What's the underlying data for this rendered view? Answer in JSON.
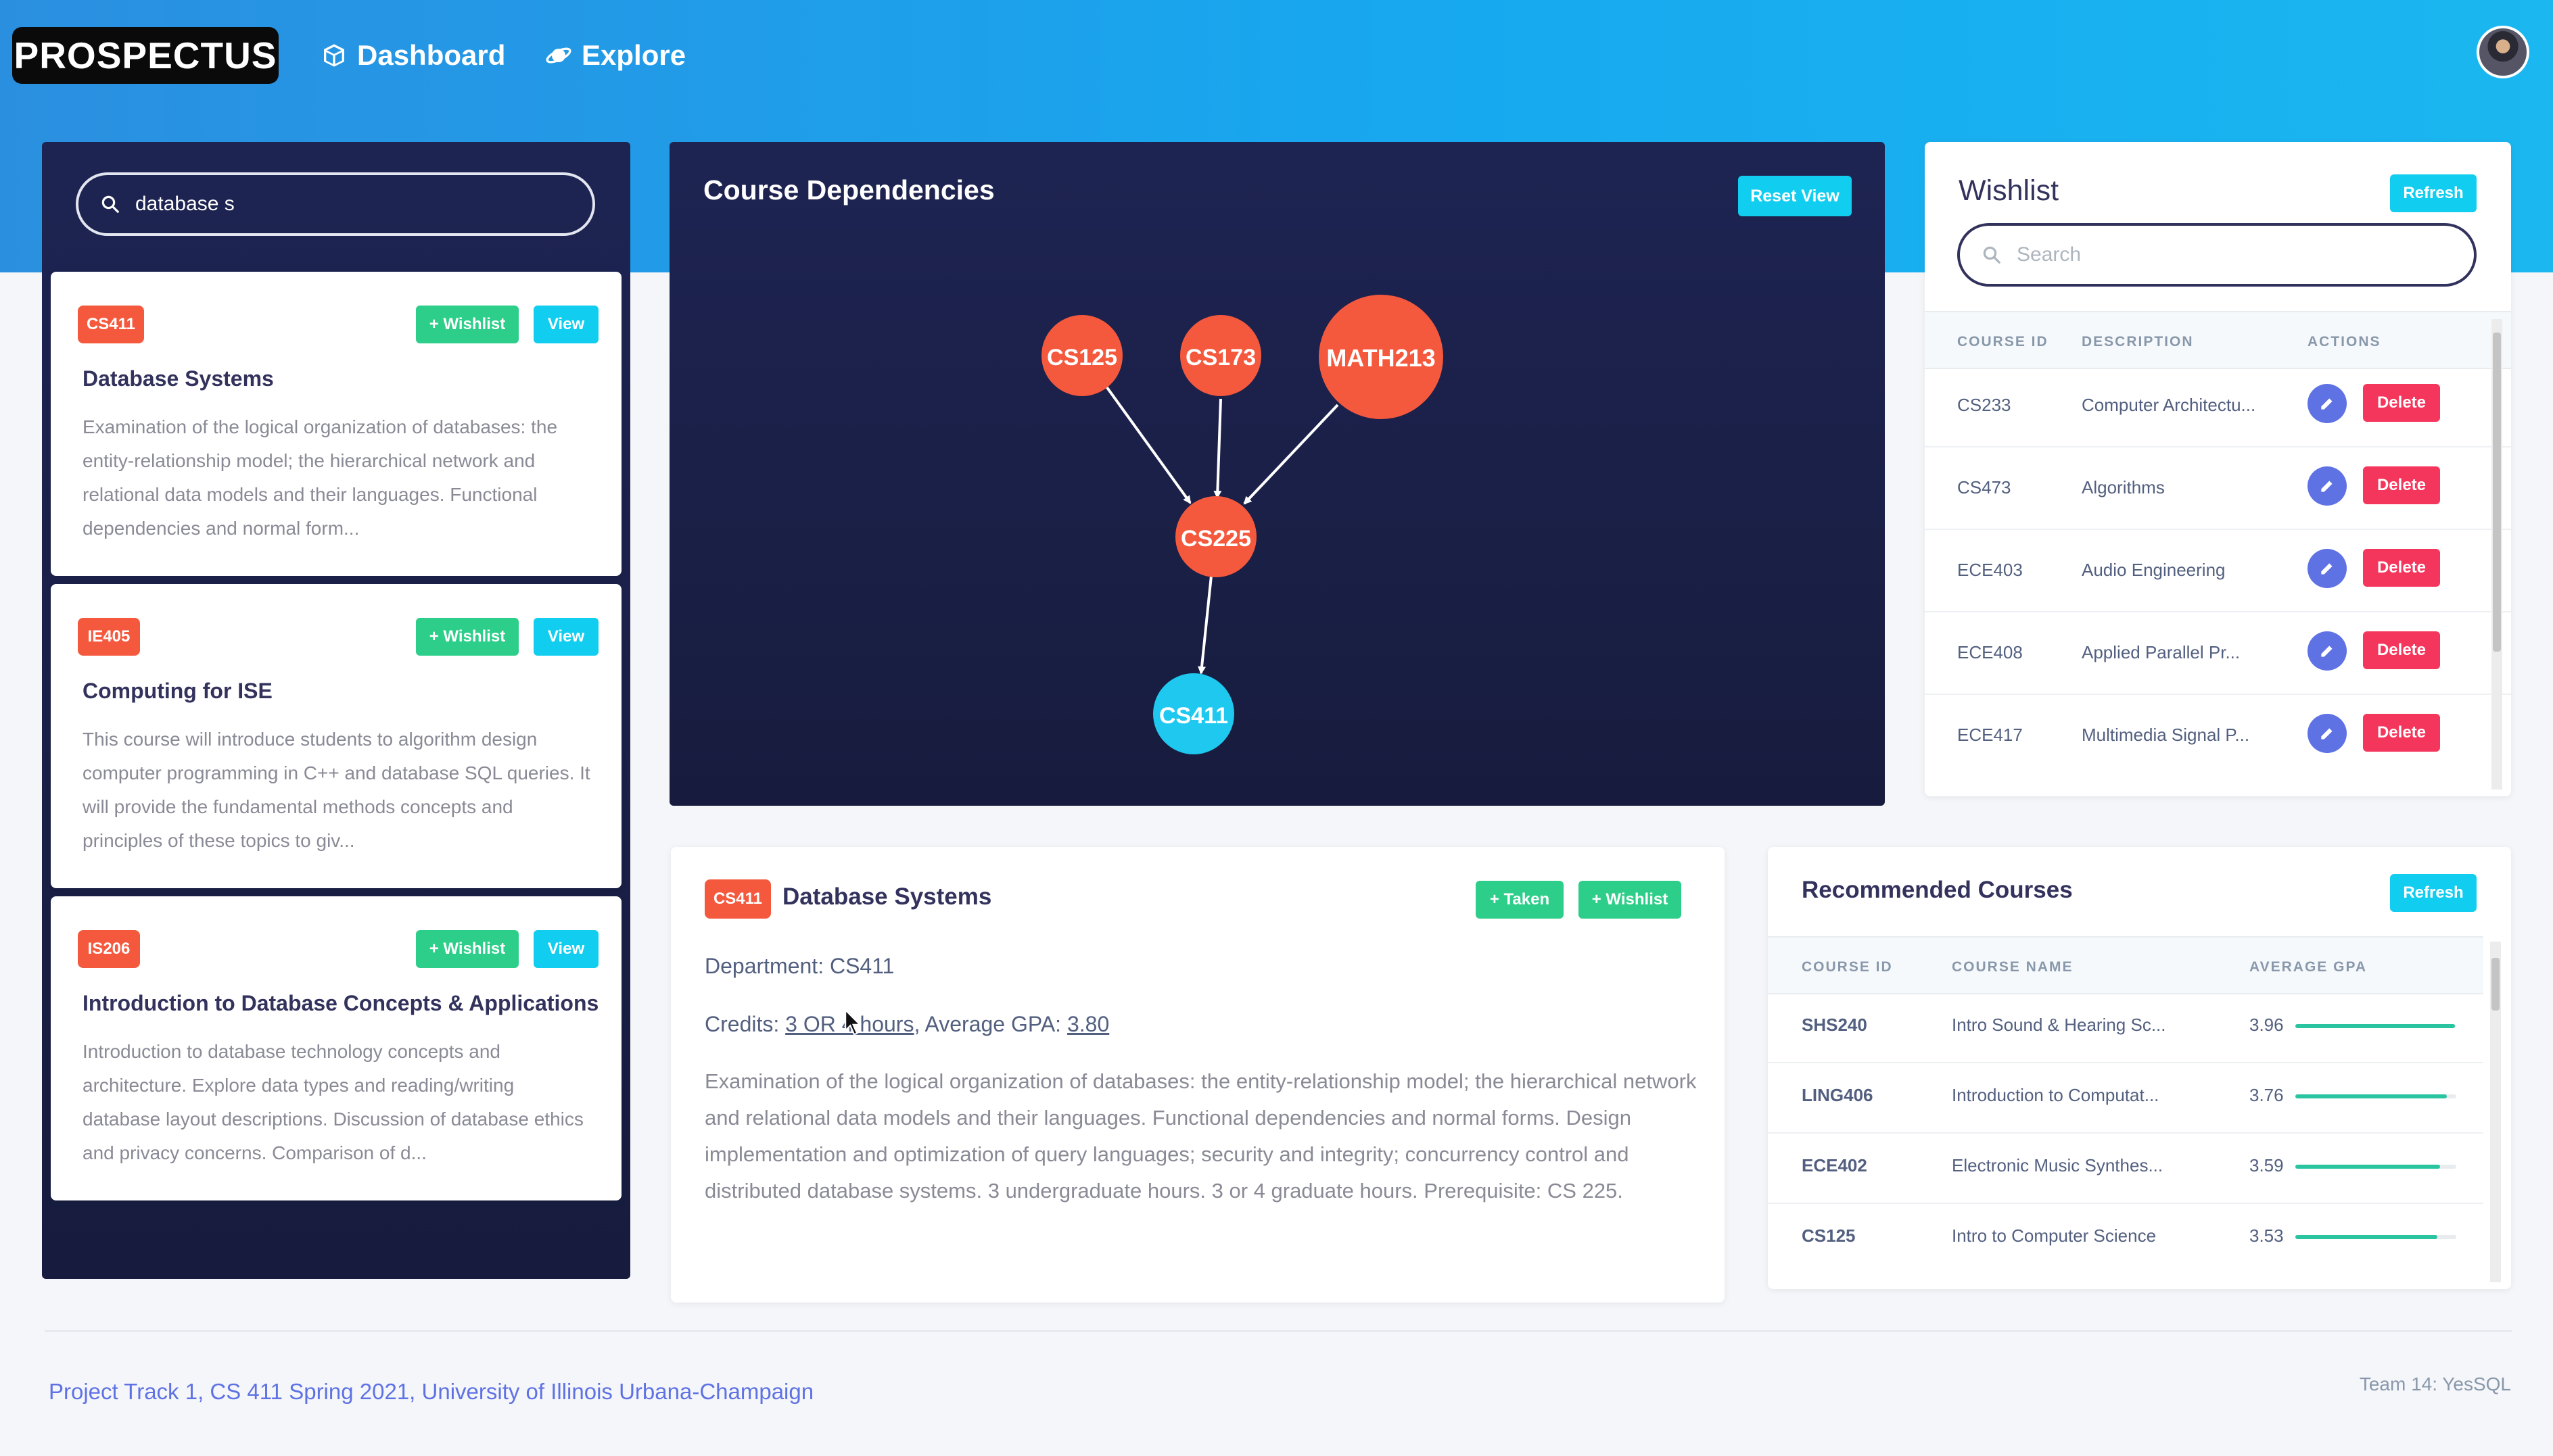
{
  "nav": {
    "brand": "PROSPECTUS",
    "dashboard": "Dashboard",
    "explore": "Explore"
  },
  "search": {
    "value": "database s"
  },
  "results": [
    {
      "code": "CS411",
      "wishlist_label": "+ Wishlist",
      "view_label": "View",
      "title": "Database Systems",
      "description": "Examination of the logical organization of databases: the entity-relationship model; the hierarchical network and relational data models and their languages. Functional dependencies and normal form..."
    },
    {
      "code": "IE405",
      "wishlist_label": "+ Wishlist",
      "view_label": "View",
      "title": "Computing for ISE",
      "description": "This course will introduce students to algorithm design computer programming in C++ and database SQL queries. It will provide the fundamental methods concepts and principles of these topics to giv..."
    },
    {
      "code": "IS206",
      "wishlist_label": "+ Wishlist",
      "view_label": "View",
      "title": "Introduction to Database Concepts & Applications",
      "description": "Introduction to database technology concepts and architecture. Explore data types and reading/writing database layout descriptions. Discussion of database ethics and privacy concerns. Comparison of d..."
    }
  ],
  "graph": {
    "title": "Course Dependencies",
    "reset_label": "Reset View",
    "nodes": [
      {
        "id": "CS125",
        "color": "#f5593d"
      },
      {
        "id": "CS173",
        "color": "#f5593d"
      },
      {
        "id": "MATH213",
        "color": "#f5593d"
      },
      {
        "id": "CS225",
        "color": "#f5593d"
      },
      {
        "id": "CS411",
        "color": "#1ec8ef"
      }
    ]
  },
  "wishlist": {
    "title": "Wishlist",
    "refresh_label": "Refresh",
    "search_placeholder": "Search",
    "headers": {
      "id": "COURSE ID",
      "desc": "DESCRIPTION",
      "actions": "ACTIONS"
    },
    "delete_label": "Delete",
    "rows": [
      {
        "id": "CS233",
        "desc": "Computer Architectu..."
      },
      {
        "id": "CS473",
        "desc": "Algorithms"
      },
      {
        "id": "ECE403",
        "desc": "Audio Engineering"
      },
      {
        "id": "ECE408",
        "desc": "Applied Parallel Pr..."
      },
      {
        "id": "ECE417",
        "desc": "Multimedia Signal P..."
      }
    ]
  },
  "detail": {
    "code": "CS411",
    "title": "Database Systems",
    "taken_label": "+ Taken",
    "wishlist_label": "+ Wishlist",
    "department_label": "Department: ",
    "department": "CS411",
    "credits_label": "Credits: ",
    "credits": "3 OR 4 hours",
    "gpa_label": ", Average GPA: ",
    "gpa": "3.80",
    "description": "Examination of the logical organization of databases: the entity-relationship model; the hierarchical network and relational data models and their languages. Functional dependencies and normal forms. Design implementation and optimization of query languages; security and integrity; concurrency control and distributed database systems. 3 undergraduate hours. 3 or 4 graduate hours. Prerequisite: CS 225."
  },
  "recommended": {
    "title": "Recommended Courses",
    "refresh_label": "Refresh",
    "headers": {
      "id": "COURSE ID",
      "name": "COURSE NAME",
      "gpa": "AVERAGE GPA"
    },
    "rows": [
      {
        "id": "SHS240",
        "name": "Intro Sound & Hearing Sc...",
        "gpa": "3.96",
        "gpa_value": 3.96
      },
      {
        "id": "LING406",
        "name": "Introduction to Computat...",
        "gpa": "3.76",
        "gpa_value": 3.76
      },
      {
        "id": "ECE402",
        "name": "Electronic Music Synthes...",
        "gpa": "3.59",
        "gpa_value": 3.59
      },
      {
        "id": "CS125",
        "name": "Intro to Computer Science",
        "gpa": "3.53",
        "gpa_value": 3.53
      }
    ]
  },
  "footer": {
    "left": "Project Track 1, CS 411 Spring 2021, University of Illinois Urbana-Champaign",
    "right": "Team 14: YesSQL"
  },
  "colors": {
    "accent_orange": "#f5593d",
    "accent_cyan": "#11cdef",
    "accent_green": "#2dce89",
    "accent_red": "#f5365c",
    "accent_indigo": "#5e72e4"
  }
}
